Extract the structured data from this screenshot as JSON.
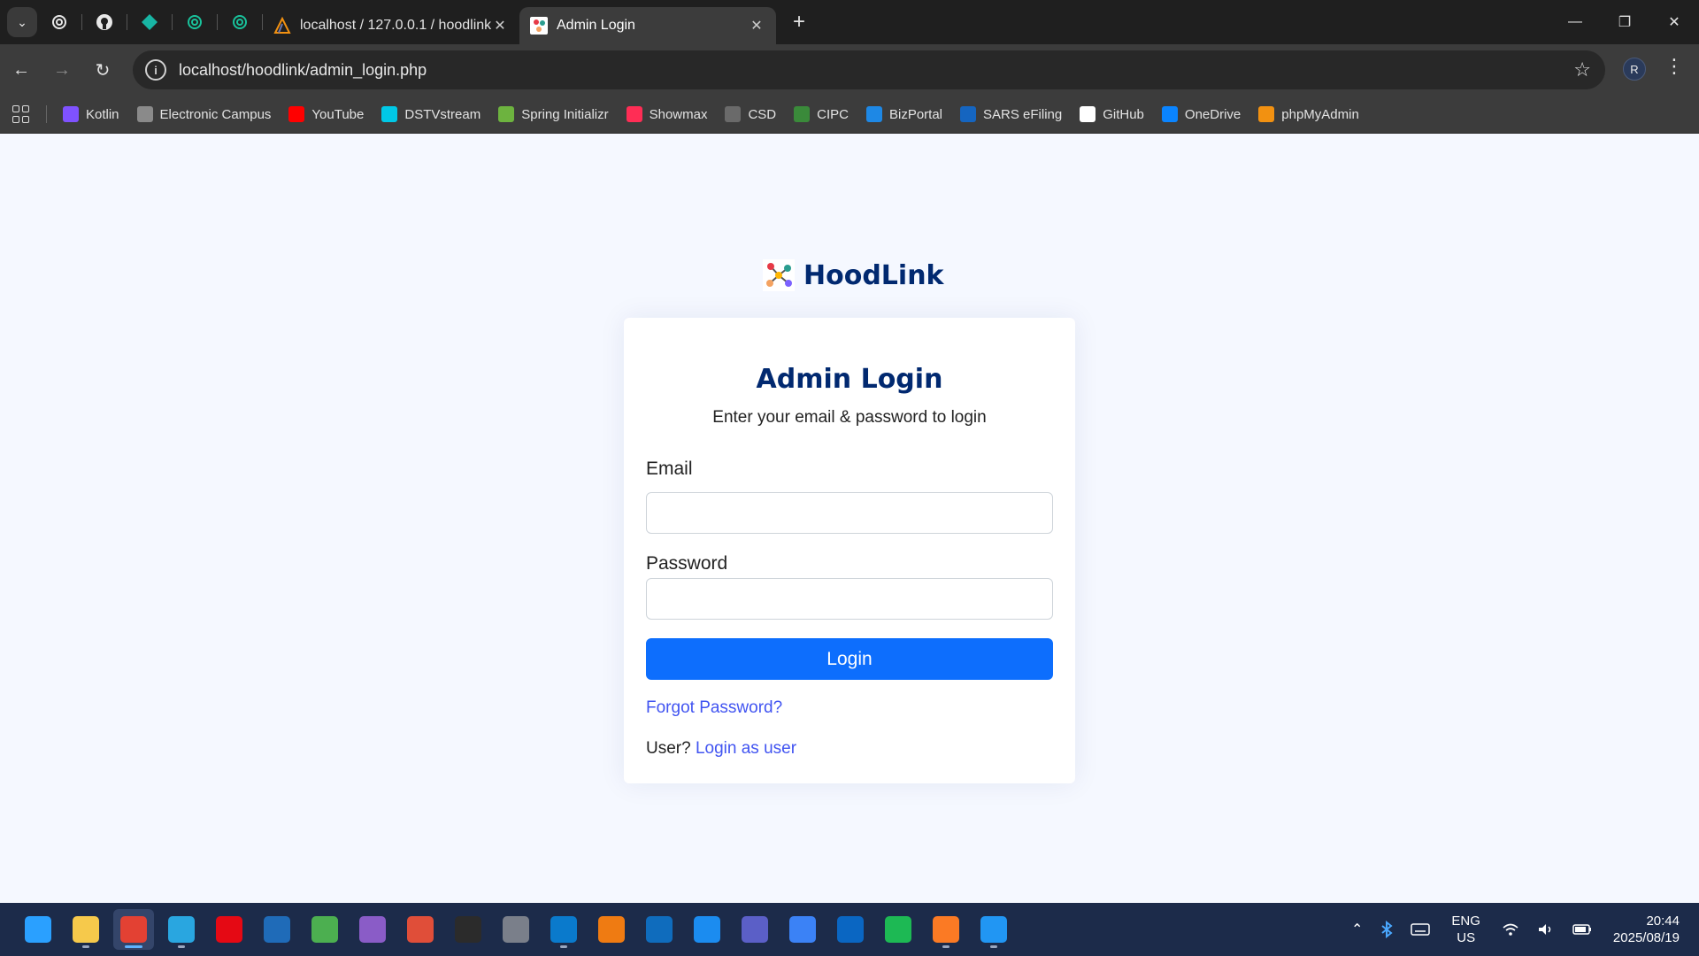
{
  "browser": {
    "tabs": [
      {
        "title": "localhost / 127.0.0.1 / hoodlink",
        "active": false
      },
      {
        "title": "Admin Login",
        "active": true
      }
    ],
    "url": "localhost/hoodlink/admin_login.php",
    "profile_initial": "R",
    "bookmarks": [
      {
        "label": "Kotlin",
        "color": "#7f52ff"
      },
      {
        "label": "Electronic Campus",
        "color": "#8a8a8a"
      },
      {
        "label": "YouTube",
        "color": "#ff0000"
      },
      {
        "label": "DSTVstream",
        "color": "#00c8e6"
      },
      {
        "label": "Spring Initializr",
        "color": "#6db33f"
      },
      {
        "label": "Showmax",
        "color": "#ff2d55"
      },
      {
        "label": "CSD",
        "color": "#6a6a6a"
      },
      {
        "label": "CIPC",
        "color": "#3a8a3a"
      },
      {
        "label": "BizPortal",
        "color": "#1e88e5"
      },
      {
        "label": "SARS eFiling",
        "color": "#1565c0"
      },
      {
        "label": "GitHub",
        "color": "#ffffff"
      },
      {
        "label": "OneDrive",
        "color": "#0a84ff"
      },
      {
        "label": "phpMyAdmin",
        "color": "#f29111"
      }
    ]
  },
  "page": {
    "brand": "HoodLink",
    "title": "Admin Login",
    "subtitle": "Enter your email & password to login",
    "email_label": "Email",
    "email_value": "",
    "password_label": "Password",
    "password_value": "",
    "login_button": "Login",
    "forgot_link": "Forgot Password?",
    "user_prompt": "User?",
    "user_link": "Login as user",
    "colors": {
      "brand": "#012970",
      "primary": "#0d6efd",
      "link": "#4154f1"
    }
  },
  "taskbar": {
    "apps": [
      {
        "name": "start-icon",
        "color": "#2aa0ff",
        "active": false,
        "open": false
      },
      {
        "name": "file-explorer-icon",
        "color": "#f6c94b",
        "active": false,
        "open": true
      },
      {
        "name": "chrome-icon",
        "color": "#e34133",
        "active": true,
        "open": true
      },
      {
        "name": "notepad-icon",
        "color": "#29a6e0",
        "active": false,
        "open": true
      },
      {
        "name": "netflix-icon",
        "color": "#e50914",
        "active": false,
        "open": false
      },
      {
        "name": "prime-video-icon",
        "color": "#1f6bb8",
        "active": false,
        "open": false
      },
      {
        "name": "gallery-icon",
        "color": "#4caf50",
        "active": false,
        "open": false
      },
      {
        "name": "box-icon",
        "color": "#8a5cc7",
        "active": false,
        "open": false
      },
      {
        "name": "git-icon",
        "color": "#e04e39",
        "active": false,
        "open": false
      },
      {
        "name": "terminal-icon",
        "color": "#2b2b2b",
        "active": false,
        "open": false
      },
      {
        "name": "sql-icon",
        "color": "#7a7f8a",
        "active": false,
        "open": false
      },
      {
        "name": "vscode-icon",
        "color": "#0a7acc",
        "active": false,
        "open": true
      },
      {
        "name": "shapes-icon",
        "color": "#ef7b12",
        "active": false,
        "open": false
      },
      {
        "name": "outlook-icon",
        "color": "#0f6cbd",
        "active": false,
        "open": false
      },
      {
        "name": "app-store-icon",
        "color": "#1b8cf0",
        "active": false,
        "open": false
      },
      {
        "name": "teams-icon",
        "color": "#5b5fc7",
        "active": false,
        "open": false
      },
      {
        "name": "calendar-icon",
        "color": "#3b82f6",
        "active": false,
        "open": false
      },
      {
        "name": "linkedin-icon",
        "color": "#0a66c2",
        "active": false,
        "open": false
      },
      {
        "name": "spotify-icon",
        "color": "#1db954",
        "active": false,
        "open": false
      },
      {
        "name": "xampp-icon",
        "color": "#fb7a24",
        "active": false,
        "open": true
      },
      {
        "name": "photos-icon",
        "color": "#2196f3",
        "active": false,
        "open": true
      }
    ],
    "lang_top": "ENG",
    "lang_bottom": "US",
    "time": "20:44",
    "date": "2025/08/19"
  }
}
